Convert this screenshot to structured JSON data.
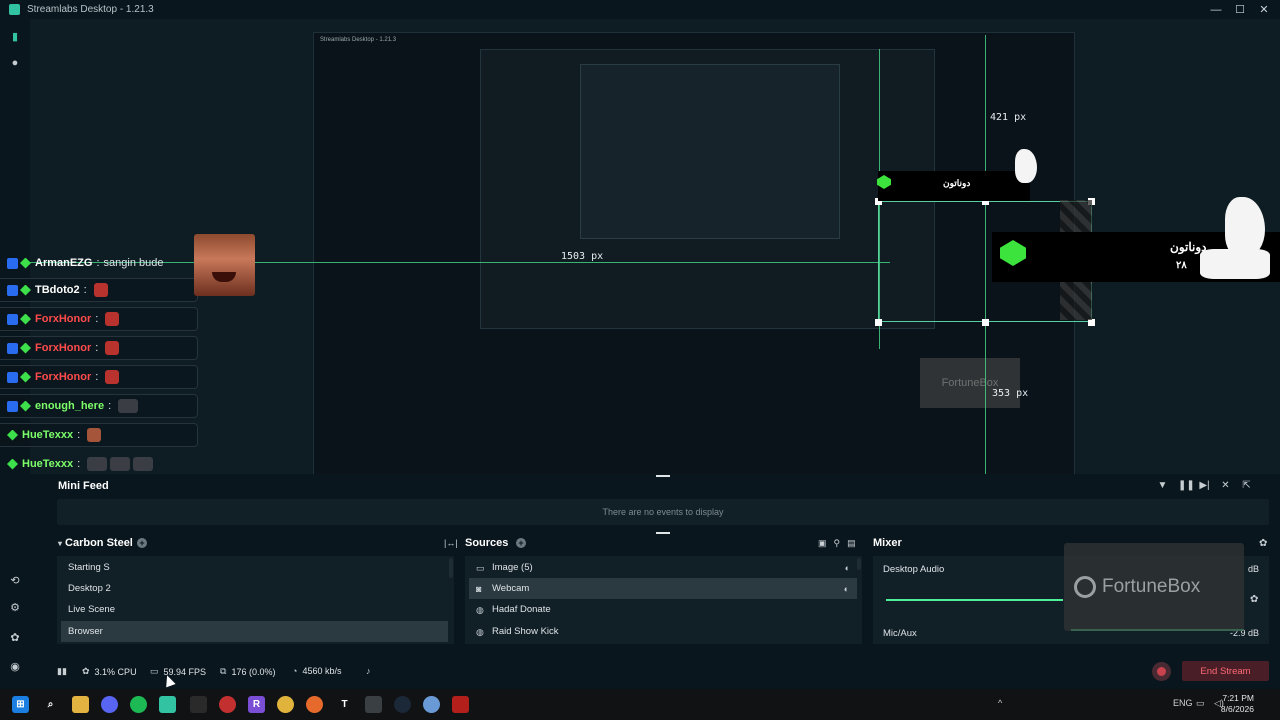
{
  "window": {
    "title": "Streamlabs Desktop - 1.21.3",
    "controls": [
      "—",
      "☐",
      "✕"
    ]
  },
  "preview": {
    "chat": [
      {
        "user": "ArmanEZG",
        "message": "sangin bude",
        "color": "#ffffff"
      },
      {
        "user": "TBdoto2",
        "message": "",
        "color": "#ffffff"
      },
      {
        "user": "ForxHonor",
        "message": "",
        "color": "#ff4b4b"
      },
      {
        "user": "ForxHonor",
        "message": "",
        "color": "#ff4b4b"
      },
      {
        "user": "ForxHonor",
        "message": "",
        "color": "#ff4b4b"
      },
      {
        "user": "enough_here",
        "message": "",
        "color": "#7dff6a"
      },
      {
        "user": "HueTexxx",
        "message": "",
        "color": "#7dff6a"
      },
      {
        "user": "HueTexxx",
        "message": "",
        "color": "#7dff6a"
      }
    ],
    "alert_name": "دوناتون",
    "alert_amount": "۲۸",
    "measure_width": "1503 px",
    "measure_top": "421 px",
    "measure_bottom": "353 px",
    "nested_title": "Streamlabs Desktop - 1.21.3",
    "nested_fortunebox": "FortuneBox"
  },
  "mini_feed": {
    "title": "Mini Feed",
    "empty": "There are no events to display"
  },
  "scenes": {
    "title": "Carbon Steel",
    "items": [
      "Starting S",
      "Desktop 2",
      "Live Scene",
      "Browser"
    ],
    "selected_index": 3
  },
  "sources": {
    "title": "Sources",
    "items": [
      {
        "label": "Image (5)",
        "icon": "folder-icon"
      },
      {
        "label": "Webcam",
        "icon": "camera-icon"
      },
      {
        "label": "Hadaf Donate",
        "icon": "globe-icon"
      },
      {
        "label": "Raid Show Kick",
        "icon": "globe-icon"
      }
    ],
    "selected_index": 1
  },
  "mixer": {
    "title": "Mixer",
    "channels": [
      {
        "label": "Desktop Audio",
        "db": "dB"
      },
      {
        "label": "Mic/Aux",
        "db": "-2.9 dB"
      }
    ]
  },
  "overlay_logo": "FortuneBox",
  "footer": {
    "cpu": "3.1% CPU",
    "fps": "59.94 FPS",
    "dropped": "176 (0.0%)",
    "bitrate": "4560 kb/s",
    "end_stream": "End Stream"
  },
  "taskbar": {
    "lang": "ENG",
    "time": "7:21 PM",
    "date": "8/6/2026"
  },
  "colors": {
    "accent": "#31c3a2",
    "guide": "#45d98a",
    "end_stream_text": "#ff6a75"
  }
}
